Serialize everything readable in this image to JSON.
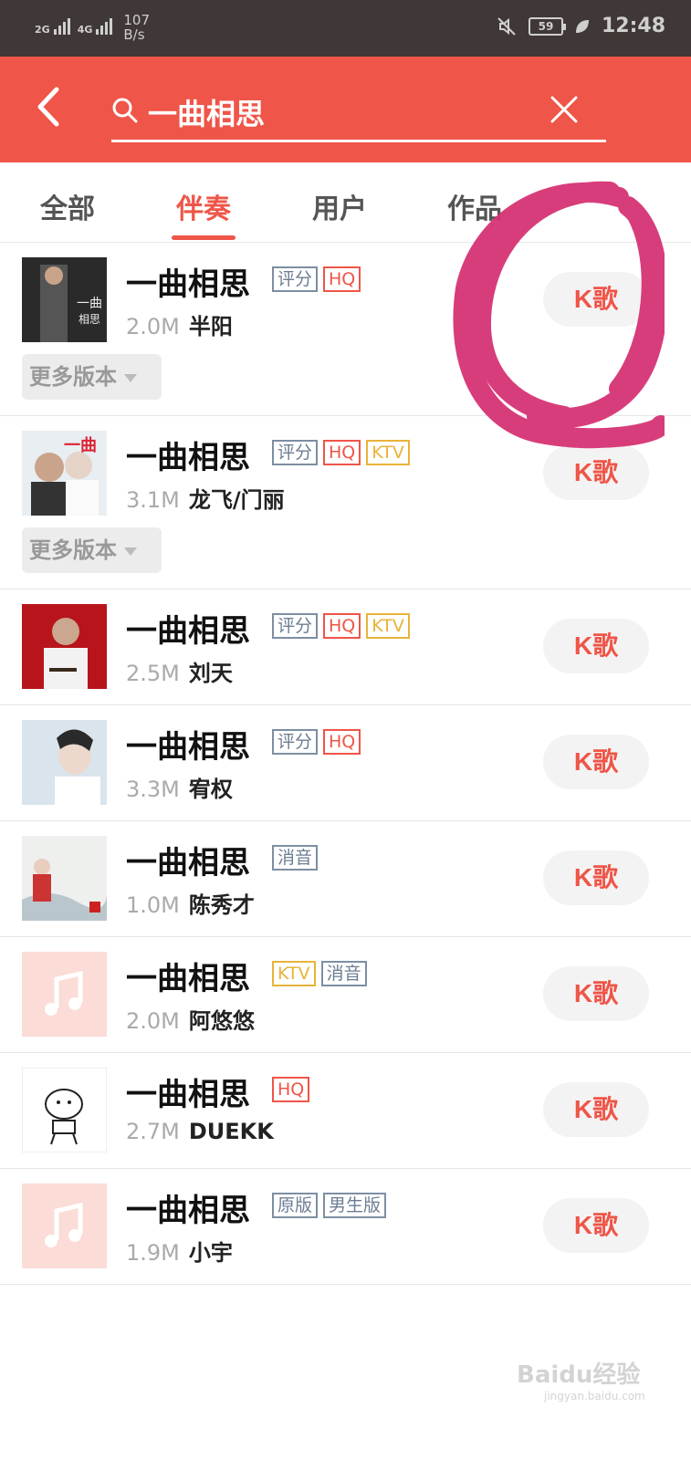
{
  "status_bar": {
    "network_1": "2G",
    "network_2": "4G",
    "speed_value": "107",
    "speed_unit": "B/s",
    "battery": "59",
    "time": "12:48"
  },
  "search": {
    "query": "一曲相思"
  },
  "tabs": [
    {
      "label": "全部"
    },
    {
      "label": "伴奏"
    },
    {
      "label": "用户"
    },
    {
      "label": "作品"
    }
  ],
  "active_tab": "伴奏",
  "results": [
    {
      "title": "一曲相思",
      "tags": [
        "评分",
        "HQ"
      ],
      "size": "2.0M",
      "artist": "半阳",
      "button": "K歌",
      "more_versions": "更多版本"
    },
    {
      "title": "一曲相思",
      "tags": [
        "评分",
        "HQ",
        "KTV"
      ],
      "size": "3.1M",
      "artist": "龙飞/门丽",
      "button": "K歌",
      "more_versions": "更多版本"
    },
    {
      "title": "一曲相思",
      "tags": [
        "评分",
        "HQ",
        "KTV"
      ],
      "size": "2.5M",
      "artist": "刘天",
      "button": "K歌"
    },
    {
      "title": "一曲相思",
      "tags": [
        "评分",
        "HQ"
      ],
      "size": "3.3M",
      "artist": "宥权",
      "button": "K歌"
    },
    {
      "title": "一曲相思",
      "tags": [
        "消音"
      ],
      "size": "1.0M",
      "artist": "陈秀才",
      "button": "K歌"
    },
    {
      "title": "一曲相思",
      "tags": [
        "KTV",
        "消音"
      ],
      "size": "2.0M",
      "artist": "阿悠悠",
      "button": "K歌"
    },
    {
      "title": "一曲相思",
      "tags": [
        "HQ"
      ],
      "size": "2.7M",
      "artist": "DUEKK",
      "button": "K歌"
    },
    {
      "title": "一曲相思",
      "tags": [
        "原版",
        "男生版"
      ],
      "size": "1.9M",
      "artist": "小宇",
      "button": "K歌"
    }
  ],
  "colors": {
    "accent": "#ef5548",
    "status_bar": "#403836",
    "tag_gray": "#6c7d92",
    "tag_yellow": "#e8b33a",
    "annotation": "#d63374"
  },
  "watermark": {
    "brand": "Baidu经验",
    "url": "jingyan.baidu.com"
  }
}
